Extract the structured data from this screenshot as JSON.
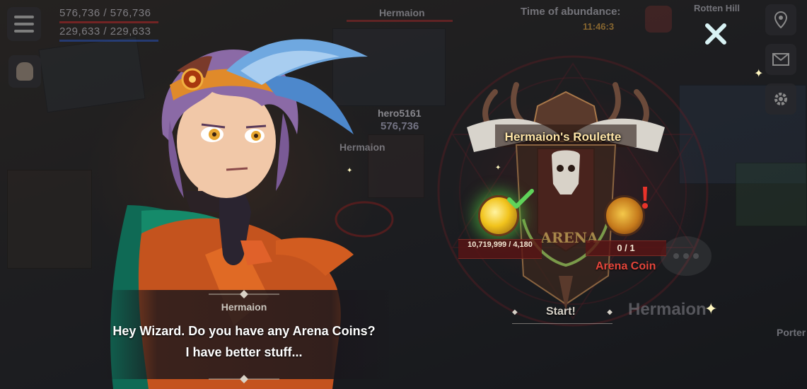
{
  "hud": {
    "hp_text": "576,736 / 576,736",
    "mp_text": "229,633 / 229,633",
    "target_name": "Hermaion",
    "event_title": "Time of abundance:",
    "event_timer": "11:46:3",
    "location": "Rotten Hill",
    "player_name": "hero5161",
    "player_hp": "576,736",
    "npc_label": "Hermaion",
    "right_npc_label": "Hermaion",
    "porter_label": "Porter"
  },
  "dialogue": {
    "speaker": "Hermaion",
    "line1": "Hey Wizard. Do you have any Arena Coins?",
    "line2": "I have better stuff..."
  },
  "roulette": {
    "title": "Hermaion's Roulette",
    "emblem_text": "ARENA",
    "gold_cost": "10,719,999 / 4,180",
    "arena_coin_count": "0 / 1",
    "arena_coin_label": "Arena Coin",
    "start_label": "Start!"
  },
  "colors": {
    "title_gold": "#ffe6a8",
    "arena_coin_red": "#e4453b",
    "check_green": "#5fd35a",
    "alert_red": "#e8332a",
    "close_cyan": "#d8f2f4"
  },
  "icons": {
    "menu": "hamburger-menu-icon",
    "bag": "inventory-bag-icon",
    "close": "close-x-icon",
    "mail": "mail-icon",
    "settings": "gear-icon",
    "map": "location-pin-icon",
    "check": "checkmark-icon",
    "alert": "exclamation-icon"
  }
}
